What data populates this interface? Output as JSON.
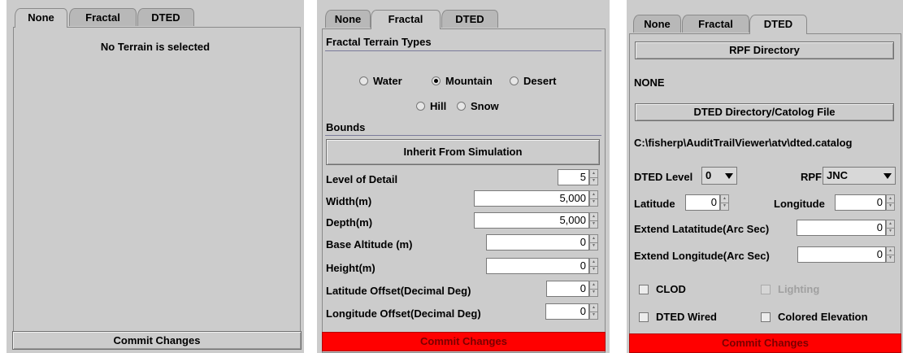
{
  "tabs": [
    "None",
    "Fractal",
    "DTED"
  ],
  "none_panel": {
    "message": "No Terrain is selected",
    "commit_label": "Commit Changes"
  },
  "fractal_panel": {
    "types_title": "Fractal Terrain Types",
    "types": [
      {
        "label": "Water",
        "selected": false
      },
      {
        "label": "Mountain",
        "selected": true
      },
      {
        "label": "Desert",
        "selected": false
      },
      {
        "label": "Hill",
        "selected": false
      },
      {
        "label": "Snow",
        "selected": false
      }
    ],
    "bounds_title": "Bounds",
    "inherit_label": "Inherit From Simulation",
    "fields": [
      {
        "label": "Level of Detail",
        "value": "5"
      },
      {
        "label": "Width(m)",
        "value": "5,000"
      },
      {
        "label": "Depth(m)",
        "value": "5,000"
      },
      {
        "label": "Base Altitude (m)",
        "value": "0"
      },
      {
        "label": "Height(m)",
        "value": "0"
      },
      {
        "label": "Latitude Offset(Decimal Deg)",
        "value": "0"
      },
      {
        "label": "Longitude Offset(Decimal Deg)",
        "value": "0"
      }
    ],
    "commit_label": "Commit Changes",
    "commit_color": "#ff0000"
  },
  "dted_panel": {
    "rpf_dir_label": "RPF Directory",
    "rpf_dir_value": "NONE",
    "dted_dir_label": "DTED Directory/Catolog File",
    "dted_dir_value": "C:\\fisherp\\AuditTrailViewer\\atv\\dted.catalog",
    "dted_level_label": "DTED Level",
    "dted_level_value": "0",
    "rpf_label": "RPF",
    "rpf_value": "JNC",
    "latitude_label": "Latitude",
    "latitude_value": "0",
    "longitude_label": "Longitude",
    "longitude_value": "0",
    "extend_lat_label": "Extend Latatitude(Arc Sec)",
    "extend_lat_value": "0",
    "extend_lon_label": "Extend Longitude(Arc Sec)",
    "extend_lon_value": "0",
    "clod_label": "CLOD",
    "lighting_label": "Lighting",
    "dted_wired_label": "DTED Wired",
    "colored_elev_label": "Colored Elevation",
    "commit_label": "Commit Changes"
  }
}
